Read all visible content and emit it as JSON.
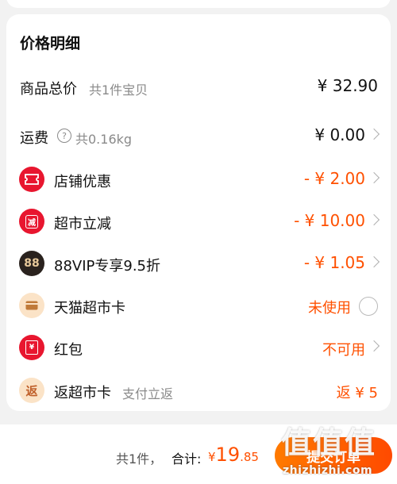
{
  "price_details": {
    "title": "价格明细",
    "goods_total": {
      "label": "商品总价",
      "sub": "共1件宝贝",
      "value": "¥ 32.90"
    },
    "shipping": {
      "label": "运费",
      "help_icon": "question-circle-icon",
      "sub": "共0.16kg",
      "value": "¥ 0.00"
    },
    "store_discount": {
      "icon": "coupon-icon",
      "icon_color": "#e8162f",
      "label": "店铺优惠",
      "value": "- ¥ 2.00"
    },
    "market_discount": {
      "icon": "minus-badge-icon",
      "icon_color": "#e8162f",
      "icon_text": "减",
      "label": "超市立减",
      "value": "- ¥ 10.00"
    },
    "vip_discount": {
      "icon": "88vip-icon",
      "icon_color": "#2a221e",
      "icon_text": "88",
      "label": "88VIP专享9.5折",
      "value": "- ¥ 1.05"
    },
    "tmall_card": {
      "icon": "card-icon",
      "icon_color": "#fbe3c7",
      "label": "天猫超市卡",
      "value": "未使用"
    },
    "red_packet": {
      "icon": "red-packet-icon",
      "icon_color": "#e8162f",
      "icon_text": "¥",
      "label": "红包",
      "value": "不可用"
    },
    "cashback_card": {
      "icon": "cashback-icon",
      "icon_color": "#fbe3c7",
      "icon_text": "返",
      "label": "返超市卡",
      "sub": "支付立返",
      "value": "返 ¥ 5"
    }
  },
  "footer": {
    "count_text": "共1件，",
    "total_label": "合计:",
    "currency": "¥",
    "total_int": "19",
    "total_dec": ".85",
    "submit_label": "提交订单"
  },
  "watermark": {
    "text": "值值值",
    "url": "zhizhizhi.com"
  },
  "colors": {
    "accent": "#ff5000",
    "red": "#e8162f"
  }
}
